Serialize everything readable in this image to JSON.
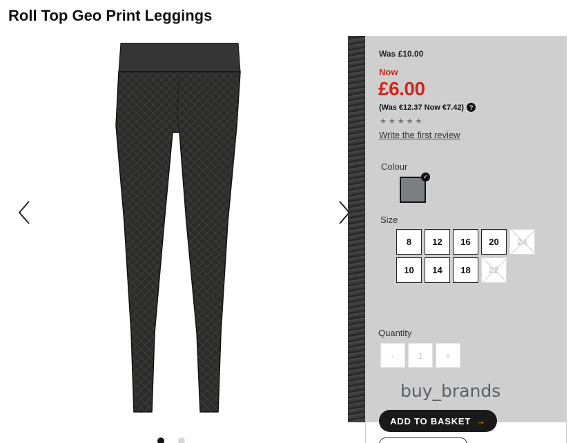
{
  "product": {
    "title": "Roll Top Geo Print Leggings"
  },
  "gallery": {
    "dots": [
      true,
      false
    ]
  },
  "price": {
    "was": "Was £10.00",
    "now_label": "Now",
    "now": "£6.00",
    "euro": "(Was €12.37 Now €7.42)",
    "help_glyph": "?"
  },
  "rating": {
    "stars": [
      "★",
      "★",
      "★",
      "★",
      "★"
    ],
    "review_link": "Write the first review"
  },
  "colour": {
    "label": "Colour",
    "swatch_color": "#7b7e82",
    "check_glyph": "✓"
  },
  "size": {
    "label": "Size",
    "options": [
      {
        "label": "8",
        "available": true
      },
      {
        "label": "12",
        "available": true
      },
      {
        "label": "16",
        "available": true
      },
      {
        "label": "20",
        "available": true
      },
      {
        "label": "24",
        "available": false
      },
      {
        "label": "10",
        "available": true
      },
      {
        "label": "14",
        "available": true
      },
      {
        "label": "18",
        "available": true
      },
      {
        "label": "22",
        "available": false
      }
    ]
  },
  "quantity": {
    "label": "Quantity",
    "minus": "-",
    "value": "1",
    "plus": "+"
  },
  "watermark": "buy_brands",
  "basket": {
    "label": "ADD TO BASKET",
    "arrow": "→"
  },
  "colors": {
    "price_red": "#d0271d",
    "panel_bg": "#cfcfcf",
    "button_dark": "#1a1a1a",
    "arrow_accent": "#f0a500"
  }
}
